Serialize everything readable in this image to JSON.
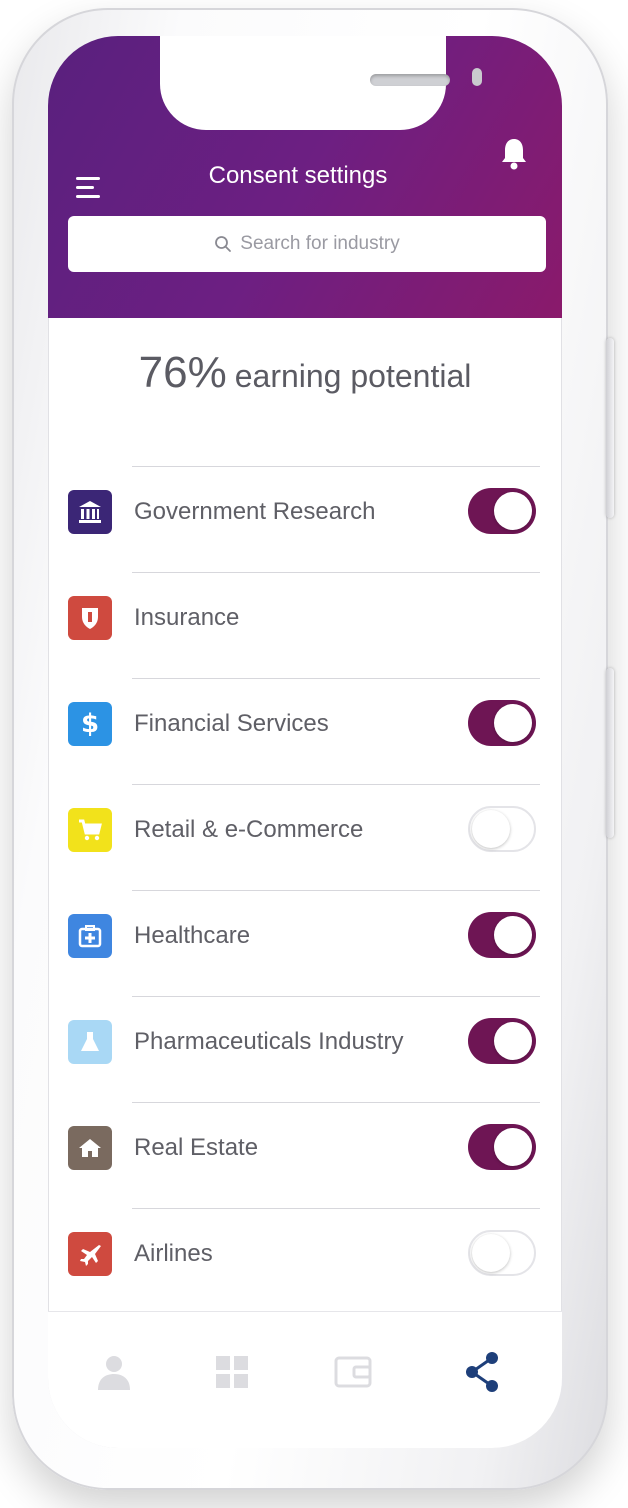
{
  "header": {
    "title": "Consent settings",
    "search_placeholder": "Search for industry"
  },
  "summary": {
    "percent": "76%",
    "label": "earning potential"
  },
  "industries": [
    {
      "label": "Government Research",
      "icon": "bank-icon",
      "color": "#3b2676",
      "toggle": true
    },
    {
      "label": "Insurance",
      "icon": "shield-icon",
      "color": "#cf4a3f",
      "toggle": null
    },
    {
      "label": "Financial Services",
      "icon": "dollar-icon",
      "color": "#2c93e4",
      "toggle": true
    },
    {
      "label": "Retail & e-Commerce",
      "icon": "cart-icon",
      "color": "#f2e21b",
      "toggle": false
    },
    {
      "label": "Healthcare",
      "icon": "medical-kit-icon",
      "color": "#3f86e0",
      "toggle": true
    },
    {
      "label": "Pharmaceuticals Industry",
      "icon": "flask-icon",
      "color": "#a9d8f5",
      "toggle": true
    },
    {
      "label": "Real Estate",
      "icon": "house-icon",
      "color": "#7a6a5f",
      "toggle": true
    },
    {
      "label": "Airlines",
      "icon": "airplane-icon",
      "color": "#cf4a3f",
      "toggle": false
    }
  ],
  "colors": {
    "header_gradient_start": "#59207e",
    "header_gradient_end": "#8a1a6b",
    "toggle_on": "#6e1554",
    "active_nav": "#1e3f7a"
  },
  "bottom_nav": [
    {
      "name": "profile",
      "icon": "person-icon",
      "active": false
    },
    {
      "name": "dashboard",
      "icon": "grid-icon",
      "active": false
    },
    {
      "name": "wallet",
      "icon": "wallet-icon",
      "active": false
    },
    {
      "name": "share",
      "icon": "share-icon",
      "active": true
    }
  ]
}
